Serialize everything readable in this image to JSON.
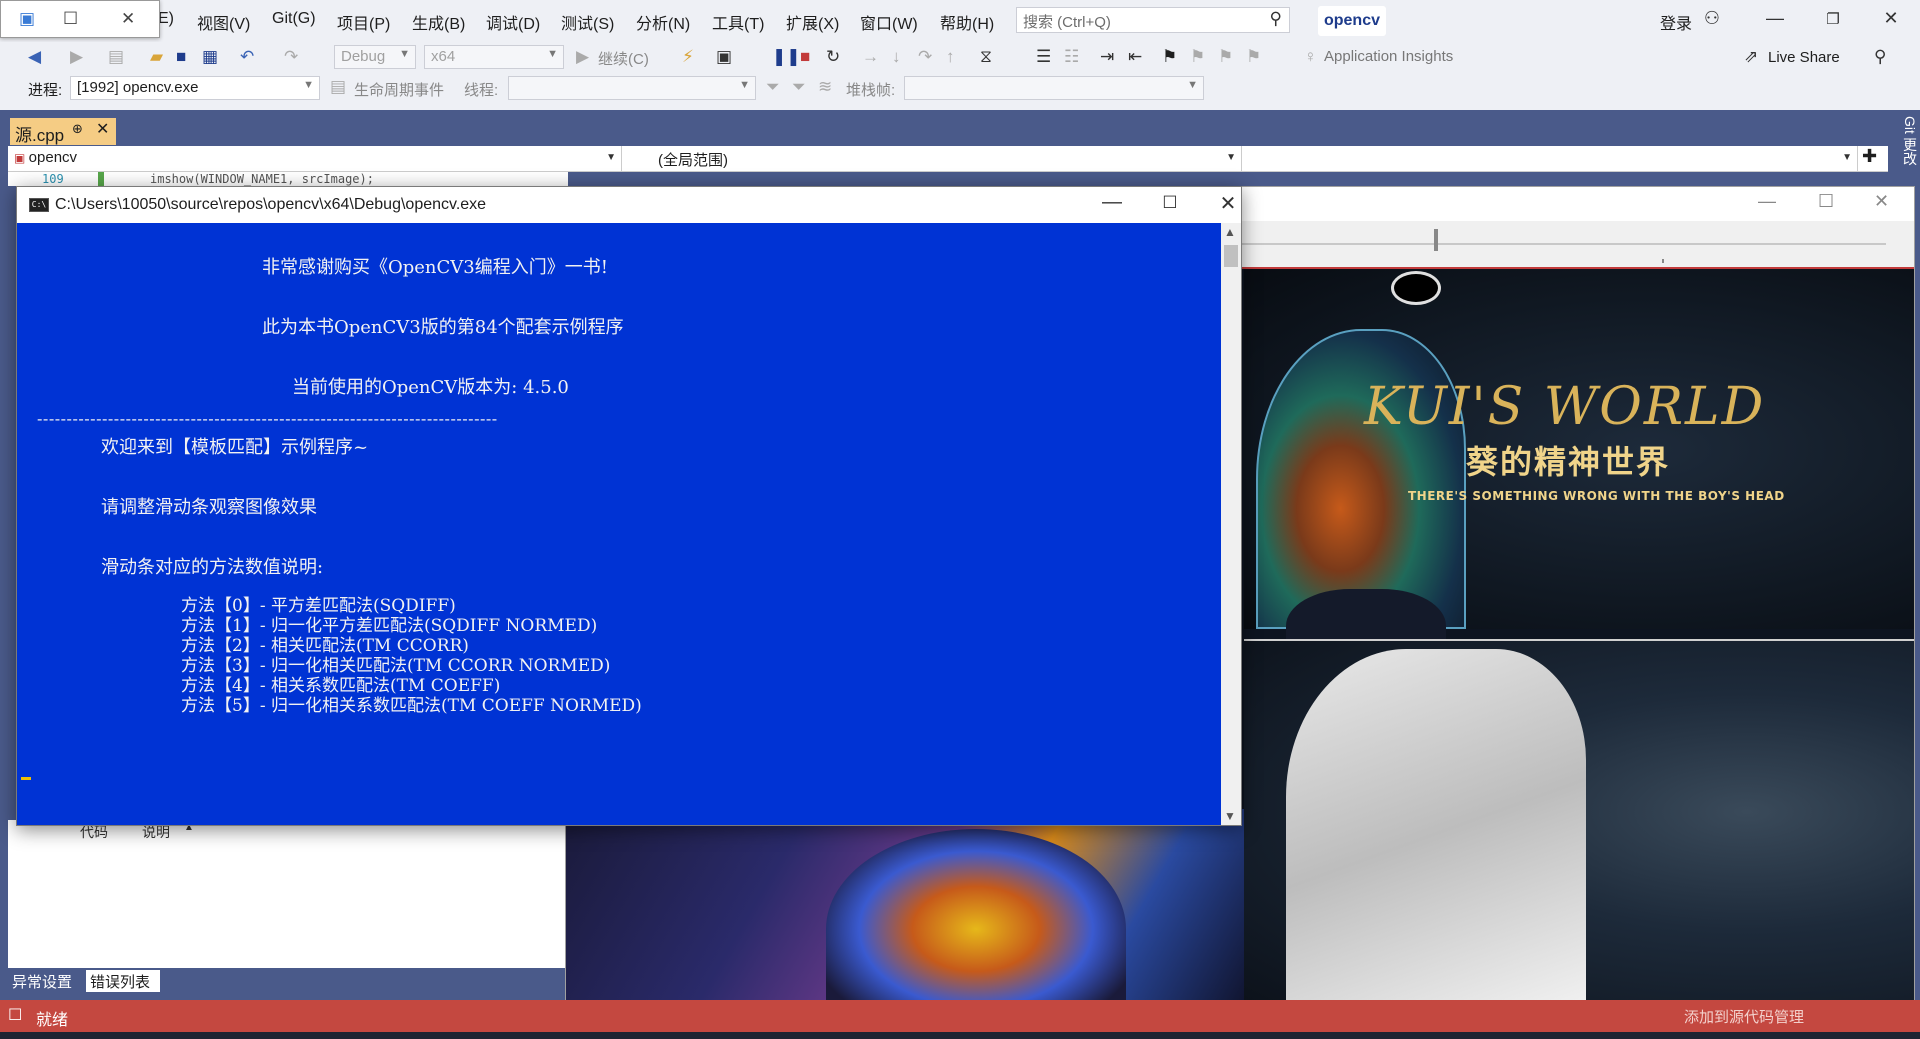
{
  "menubar": {
    "items": [
      "E)",
      "视图(V)",
      "Git(G)",
      "项目(P)",
      "生成(B)",
      "调试(D)",
      "测试(S)",
      "分析(N)",
      "工具(T)",
      "扩展(X)",
      "窗口(W)",
      "帮助(H)"
    ],
    "search_placeholder": "搜索 (Ctrl+Q)",
    "project_name": "opencv",
    "login": "登录"
  },
  "toolbar1": {
    "config": "Debug",
    "platform": "x64",
    "continue": "继续(C)",
    "app_insights": "Application Insights",
    "live_share": "Live Share"
  },
  "toolbar2": {
    "process_label": "进程:",
    "process_value": "[1992] opencv.exe",
    "lifecycle": "生命周期事件",
    "thread_label": "线程:",
    "stack_label": "堆栈帧:"
  },
  "editor": {
    "tab_name": "源.cpp",
    "nav_project": "opencv",
    "nav_scope": "(全局范围)",
    "line_number": "109",
    "code_line": "imshow(WINDOW_NAME1, srcImage);",
    "git_changes": "Git 更改"
  },
  "bottom_panel": {
    "col_code": "代码",
    "col_desc": "说明",
    "tabs": [
      "异常设置",
      "错误列表"
    ]
  },
  "status": {
    "ready": "就绪",
    "right": "添加到源代码管理"
  },
  "console": {
    "title": "C:\\Users\\10050\\source\\repos\\opencv\\x64\\Debug\\opencv.exe",
    "lines": {
      "l1": "非常感谢购买《OpenCV3编程入门》一书!",
      "l2": "此为本书OpenCV3版的第84个配套示例程序",
      "l3": "当前使用的OpenCV版本为: 4.5.0",
      "sep": "------------------------------------------------------------------------------",
      "l4": "欢迎来到【模板匹配】示例程序~",
      "l5": "请调整滑动条观察图像效果",
      "l6": "滑动条对应的方法数值说明:",
      "m0": "方法【0】- 平方差匹配法(SQDIFF)",
      "m1": "方法【1】- 归一化平方差匹配法(SQDIFF NORMED)",
      "m2": "方法【2】- 相关匹配法(TM CCORR)",
      "m3": "方法【3】- 归一化相关匹配法(TM CCORR NORMED)",
      "m4": "方法【4】- 相关系数匹配法(TM COEFF)",
      "m5": "方法【5】- 归一化相关系数匹配法(TM COEFF NORMED)"
    }
  },
  "image_window": {
    "poster_title": "KUI'S WORLD",
    "poster_subtitle": "葵的精神世界",
    "poster_tagline": "THERE'S SOMETHING WRONG WITH THE BOY'S HEAD"
  },
  "colors": {
    "console_bg": "#0033d4",
    "status_bar": "#c44840",
    "tab_active": "#f5cc84"
  }
}
